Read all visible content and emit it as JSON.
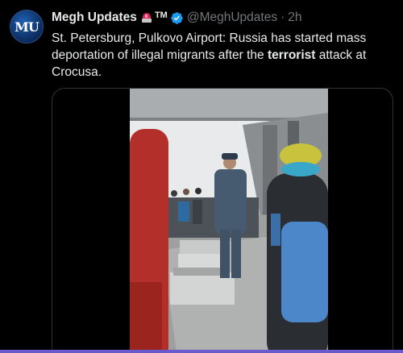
{
  "author": {
    "avatar_text": "MU",
    "display_name": "Megh Updates",
    "badge": "TM",
    "handle": "@MeghUpdates",
    "separator": "·",
    "time": "2h"
  },
  "tweet": {
    "text_before": "St. Petersburg, Pulkovo Airport: Russia has started mass deportation of illegal migrants after the ",
    "text_bold": "terrorist",
    "text_after": " attack at Crocusa."
  },
  "media": {
    "type": "video"
  },
  "colors": {
    "background": "#000000",
    "text": "#e7e9ea",
    "muted": "#71767b",
    "verified": "#1d9bf0",
    "border": "#2f3336"
  },
  "icons": [
    "siren-icon",
    "verified-badge-icon"
  ]
}
